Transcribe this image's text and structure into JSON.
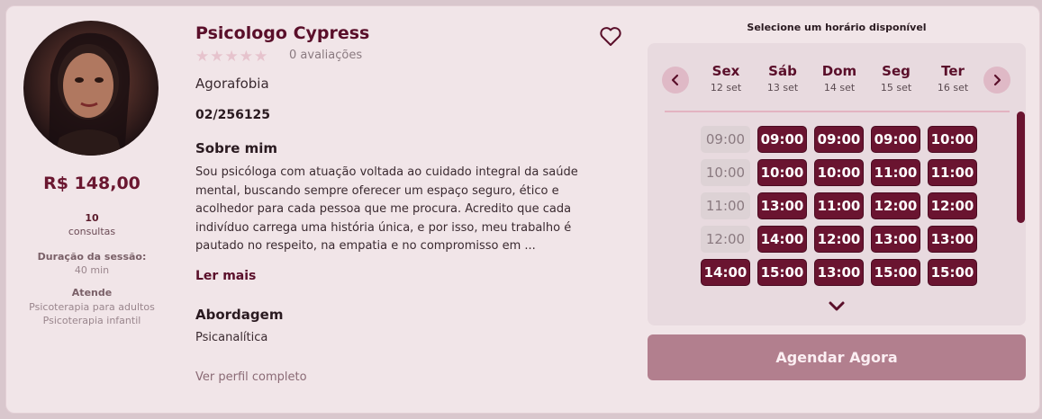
{
  "profile": {
    "price": "R$ 148,00",
    "consult_count": "10",
    "consult_label": "consultas",
    "duration_title": "Duração da sessão:",
    "duration_value": "40 min",
    "atende_title": "Atende",
    "atende_items": [
      "Psicoterapia para adultos",
      "Psicoterapia infantil"
    ]
  },
  "main": {
    "name": "Psicologo Cypress",
    "stars": "★★★★★",
    "rating_count": 0,
    "rating_text": "0 avaliações",
    "specialty": "Agorafobia",
    "crp": "02/256125",
    "about_title": "Sobre mim",
    "about_text": "Sou psicóloga com atuação voltada ao cuidado integral da saúde mental, buscando sempre oferecer um espaço seguro, ético e acolhedor para cada pessoa que me procura. Acredito que cada indivíduo carrega uma história única, e por isso, meu trabalho é pautado no respeito, na empatia e no compromisso em ...",
    "read_more": "Ler mais",
    "approach_title": "Abordagem",
    "approach_value": "Psicanalítica",
    "full_profile": "Ver perfil completo"
  },
  "schedule": {
    "title": "Selecione um horário disponível",
    "prev_icon": "chevron-left-icon",
    "next_icon": "chevron-right-icon",
    "days": [
      {
        "name": "Sex",
        "date": "12 set"
      },
      {
        "name": "Sáb",
        "date": "13 set"
      },
      {
        "name": "Dom",
        "date": "14 set"
      },
      {
        "name": "Seg",
        "date": "15 set"
      },
      {
        "name": "Ter",
        "date": "16 set"
      }
    ],
    "slots": [
      [
        {
          "time": "09:00",
          "available": false
        },
        {
          "time": "10:00",
          "available": false
        },
        {
          "time": "11:00",
          "available": false
        },
        {
          "time": "12:00",
          "available": false
        },
        {
          "time": "14:00",
          "available": true
        }
      ],
      [
        {
          "time": "09:00",
          "available": true
        },
        {
          "time": "10:00",
          "available": true
        },
        {
          "time": "13:00",
          "available": true
        },
        {
          "time": "14:00",
          "available": true
        },
        {
          "time": "15:00",
          "available": true
        }
      ],
      [
        {
          "time": "09:00",
          "available": true
        },
        {
          "time": "10:00",
          "available": true
        },
        {
          "time": "11:00",
          "available": true
        },
        {
          "time": "12:00",
          "available": true
        },
        {
          "time": "13:00",
          "available": true
        }
      ],
      [
        {
          "time": "09:00",
          "available": true
        },
        {
          "time": "11:00",
          "available": true
        },
        {
          "time": "12:00",
          "available": true
        },
        {
          "time": "13:00",
          "available": true
        },
        {
          "time": "15:00",
          "available": true
        }
      ],
      [
        {
          "time": "10:00",
          "available": true
        },
        {
          "time": "11:00",
          "available": true
        },
        {
          "time": "12:00",
          "available": true
        },
        {
          "time": "13:00",
          "available": true
        },
        {
          "time": "15:00",
          "available": true
        }
      ]
    ],
    "book_label": "Agendar Agora"
  },
  "colors": {
    "accent": "#6a1430",
    "background": "#f1e5e8",
    "book_button": "#b27f8e"
  }
}
